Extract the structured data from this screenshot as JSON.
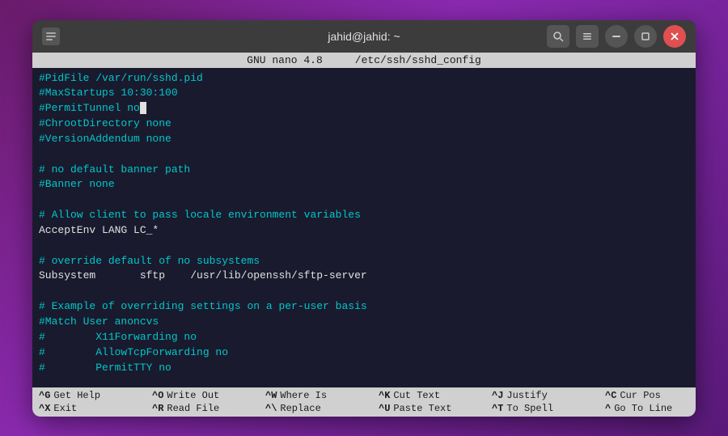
{
  "window": {
    "title": "jahid@jahid: ~",
    "app_icon": "▤"
  },
  "titlebar": {
    "search_btn": "🔍",
    "menu_btn": "☰",
    "minimize_btn": "−",
    "maximize_btn": "□",
    "close_btn": "✕"
  },
  "nano_header": {
    "left": "GNU nano 4.8",
    "center": "/etc/ssh/sshd_config"
  },
  "editor": {
    "lines": [
      "#PidFile /var/run/sshd.pid",
      "#MaxStartups 10:30:100",
      "#PermitTunnel no",
      "#ChrootDirectory none",
      "#VersionAddendum none",
      "",
      "# no default banner path",
      "#Banner none",
      "",
      "# Allow client to pass locale environment variables",
      "AcceptEnv LANG LC_*",
      "",
      "# override default of no subsystems",
      "Subsystem       sftp    /usr/lib/openssh/sftp-server",
      "",
      "# Example of overriding settings on a per-user basis",
      "#Match User anoncvs",
      "#        X11Forwarding no",
      "#        AllowTcpForwarding no",
      "#        PermitTTY no"
    ]
  },
  "footer": {
    "rows": [
      [
        {
          "key": "^G",
          "label": "Get Help"
        },
        {
          "key": "^O",
          "label": "Write Out"
        },
        {
          "key": "^W",
          "label": "Where Is"
        },
        {
          "key": "^K",
          "label": "Cut Text"
        },
        {
          "key": "^J",
          "label": "Justify"
        },
        {
          "key": "^C",
          "label": "Cur Pos"
        }
      ],
      [
        {
          "key": "^X",
          "label": "Exit"
        },
        {
          "key": "^R",
          "label": "Read File"
        },
        {
          "key": "^\\",
          "label": "Replace"
        },
        {
          "key": "^U",
          "label": "Paste Text"
        },
        {
          "key": "^T",
          "label": "To Spell"
        },
        {
          "key": "^",
          "label": "Go To Line"
        }
      ]
    ]
  }
}
